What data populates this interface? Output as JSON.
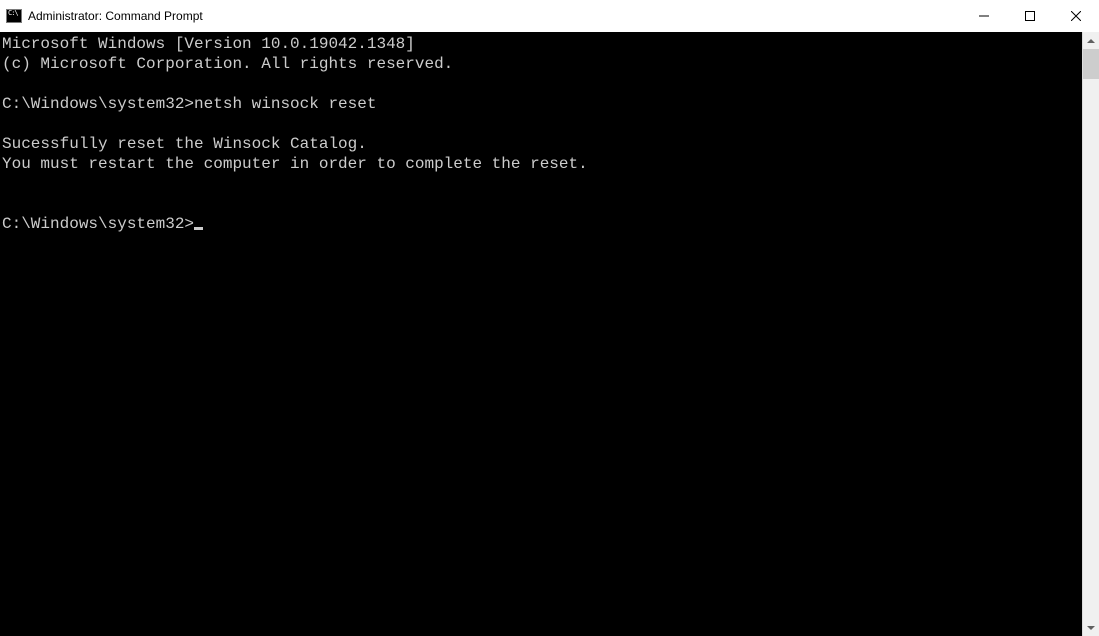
{
  "titlebar": {
    "title": "Administrator: Command Prompt"
  },
  "terminal": {
    "line1": "Microsoft Windows [Version 10.0.19042.1348]",
    "line2": "(c) Microsoft Corporation. All rights reserved.",
    "blank1": "",
    "prompt1": "C:\\Windows\\system32>",
    "command1": "netsh winsock reset",
    "blank2": "",
    "output1": "Sucessfully reset the Winsock Catalog.",
    "output2": "You must restart the computer in order to complete the reset.",
    "blank3": "",
    "blank4": "",
    "prompt2": "C:\\Windows\\system32>"
  },
  "scrollbar": {
    "thumbTop": "0px",
    "thumbHeight": "30px"
  }
}
